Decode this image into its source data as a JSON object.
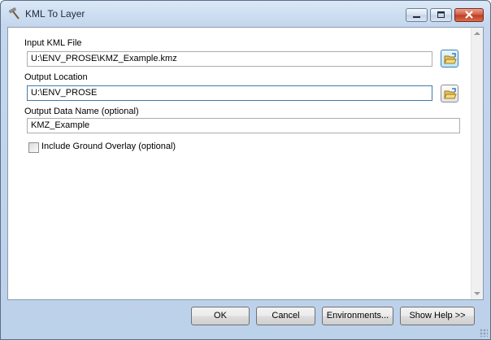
{
  "window": {
    "title": "KML To Layer",
    "icons": {
      "app": "hammer-icon",
      "minimize": "minimize-icon",
      "maximize": "maximize-icon",
      "close": "close-icon"
    }
  },
  "form": {
    "input_kml": {
      "label": "Input KML File",
      "value": "U:\\ENV_PROSE\\KMZ_Example.kmz"
    },
    "output_location": {
      "label": "Output Location",
      "value": "U:\\ENV_PROSE"
    },
    "output_name": {
      "label": "Output Data Name (optional)",
      "value": "KMZ_Example"
    },
    "ground_overlay": {
      "label": "Include Ground Overlay (optional)",
      "checked": false
    }
  },
  "buttons": {
    "ok": "OK",
    "cancel": "Cancel",
    "environments": "Environments...",
    "show_help": "Show Help >>"
  },
  "colors": {
    "titlebar": "#c4d7ee",
    "close_button": "#c8452c",
    "folder": "#e8c15a",
    "focus_border": "#3d7bad"
  }
}
